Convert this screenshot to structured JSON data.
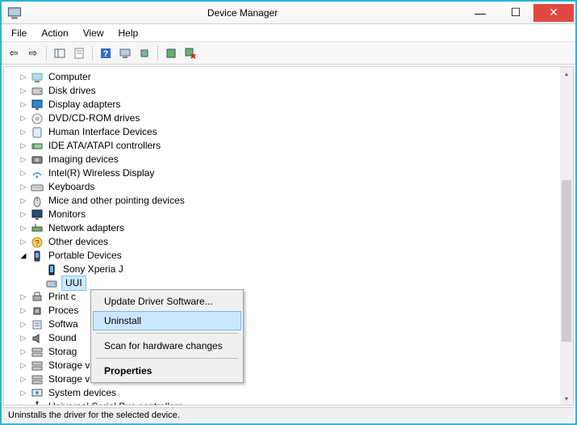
{
  "window": {
    "title": "Device Manager"
  },
  "menu": {
    "file": "File",
    "action": "Action",
    "view": "View",
    "help": "Help"
  },
  "tree": {
    "items": [
      {
        "label": "Computer",
        "icon": "computer"
      },
      {
        "label": "Disk drives",
        "icon": "disk"
      },
      {
        "label": "Display adapters",
        "icon": "display"
      },
      {
        "label": "DVD/CD-ROM drives",
        "icon": "dvd"
      },
      {
        "label": "Human Interface Devices",
        "icon": "hid"
      },
      {
        "label": "IDE ATA/ATAPI controllers",
        "icon": "ide"
      },
      {
        "label": "Imaging devices",
        "icon": "imaging"
      },
      {
        "label": "Intel(R) Wireless Display",
        "icon": "wireless"
      },
      {
        "label": "Keyboards",
        "icon": "keyboard"
      },
      {
        "label": "Mice and other pointing devices",
        "icon": "mouse"
      },
      {
        "label": "Monitors",
        "icon": "monitor"
      },
      {
        "label": "Network adapters",
        "icon": "network"
      },
      {
        "label": "Other devices",
        "icon": "other"
      },
      {
        "label": "Portable Devices",
        "icon": "portable",
        "expanded": true,
        "children": [
          {
            "label": "Sony Xperia J",
            "icon": "phone"
          },
          {
            "label": "UUI",
            "icon": "drive",
            "selected": true
          }
        ]
      },
      {
        "label": "Print c",
        "icon": "printer",
        "truncated": true
      },
      {
        "label": "Proces",
        "icon": "cpu",
        "truncated": true
      },
      {
        "label": "Softwa",
        "icon": "software",
        "truncated": true
      },
      {
        "label": "Sound",
        "icon": "sound",
        "truncated": true
      },
      {
        "label": "Storag",
        "icon": "storage",
        "truncated": true
      },
      {
        "label": "Storage volume shadow copies",
        "icon": "storage"
      },
      {
        "label": "Storage volumes",
        "icon": "storage"
      },
      {
        "label": "System devices",
        "icon": "system"
      },
      {
        "label": "Universal Serial Bus controllers",
        "icon": "usb"
      }
    ]
  },
  "context_menu": {
    "update": "Update Driver Software...",
    "uninstall": "Uninstall",
    "scan": "Scan for hardware changes",
    "properties": "Properties"
  },
  "statusbar": {
    "text": "Uninstalls the driver for the selected device."
  }
}
